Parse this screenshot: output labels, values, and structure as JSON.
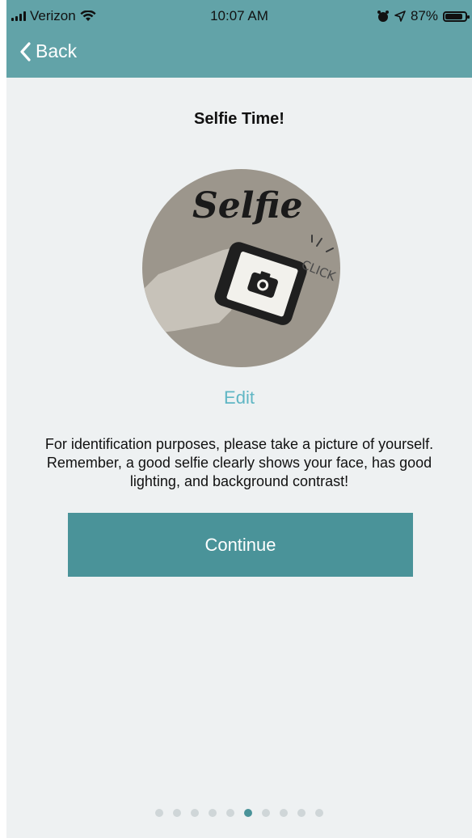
{
  "status_bar": {
    "carrier": "Verizon",
    "time": "10:07 AM",
    "battery": "87%",
    "battery_level": 0.87
  },
  "nav": {
    "back_label": "Back"
  },
  "content": {
    "title": "Selfie Time!",
    "image_text_main": "Selfie",
    "image_text_click": "CLICK",
    "edit_label": "Edit",
    "description": "For identification purposes, please take a picture of yourself. Remember, a good selfie clearly shows your face, has good lighting, and background contrast!",
    "continue_label": "Continue"
  },
  "pagination": {
    "total": 10,
    "current": 6
  },
  "colors": {
    "header": "#62a3a8",
    "button": "#4a9399",
    "link": "#5fb6c4",
    "background": "#eef1f2"
  }
}
